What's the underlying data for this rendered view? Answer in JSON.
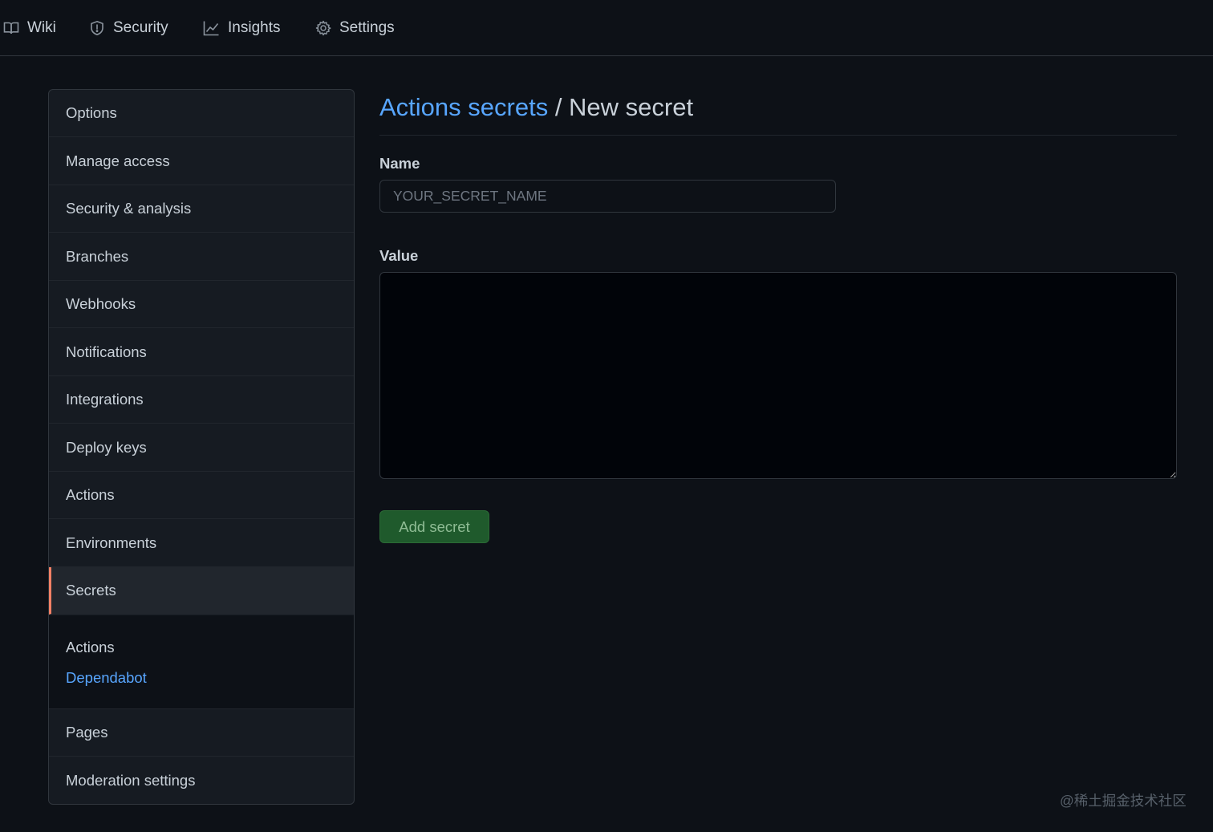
{
  "topnav": {
    "tabs": [
      {
        "label": "Wiki",
        "icon": "book-icon"
      },
      {
        "label": "Security",
        "icon": "shield-icon"
      },
      {
        "label": "Insights",
        "icon": "graph-icon"
      },
      {
        "label": "Settings",
        "icon": "gear-icon"
      }
    ]
  },
  "sidebar": {
    "items": [
      {
        "label": "Options"
      },
      {
        "label": "Manage access"
      },
      {
        "label": "Security & analysis"
      },
      {
        "label": "Branches"
      },
      {
        "label": "Webhooks"
      },
      {
        "label": "Notifications"
      },
      {
        "label": "Integrations"
      },
      {
        "label": "Deploy keys"
      },
      {
        "label": "Actions"
      },
      {
        "label": "Environments"
      },
      {
        "label": "Secrets",
        "selected": true
      }
    ],
    "subnav": [
      {
        "label": "Actions",
        "active": true
      },
      {
        "label": "Dependabot",
        "active": false
      }
    ],
    "items_after": [
      {
        "label": "Pages"
      },
      {
        "label": "Moderation settings"
      }
    ],
    "selected_accent": "#f78166"
  },
  "main": {
    "breadcrumb_link": "Actions secrets",
    "breadcrumb_separator": " / ",
    "title": "New secret",
    "name_label": "Name",
    "name_placeholder": "YOUR_SECRET_NAME",
    "name_value": "",
    "value_label": "Value",
    "value_text": "",
    "submit_label": "Add secret"
  },
  "colors": {
    "background": "#0d1117",
    "link": "#58a6ff",
    "button_bg": "#1f5a2c"
  },
  "watermark": "@稀土掘金技术社区"
}
